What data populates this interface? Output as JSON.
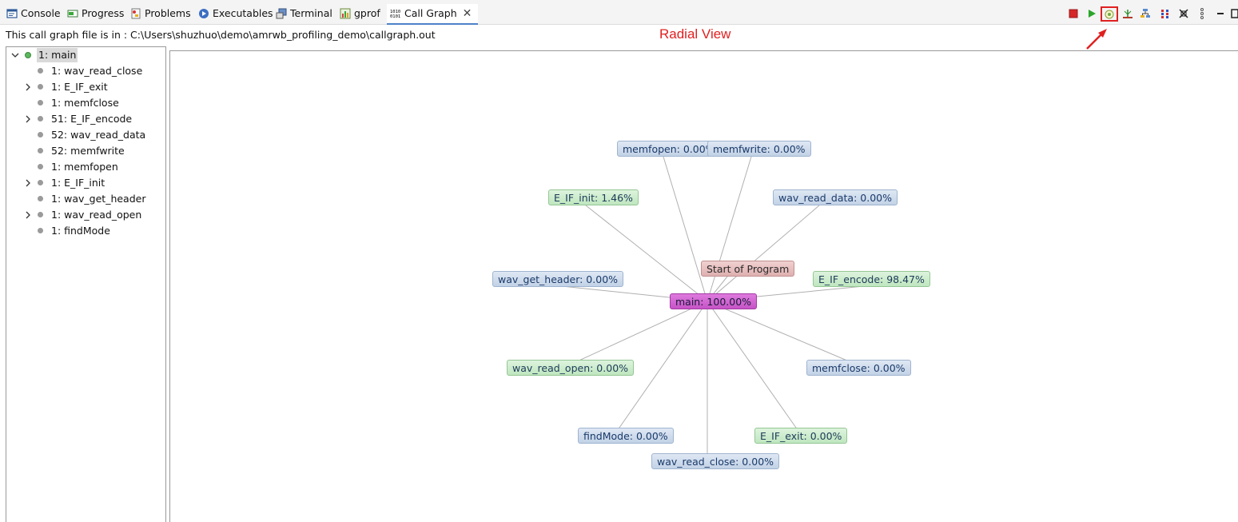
{
  "tabs": [
    {
      "label": "Console",
      "icon": "console-icon"
    },
    {
      "label": "Progress",
      "icon": "progress-icon"
    },
    {
      "label": "Problems",
      "icon": "problems-icon"
    },
    {
      "label": "Executables",
      "icon": "executables-icon"
    },
    {
      "label": "Terminal",
      "icon": "terminal-icon"
    },
    {
      "label": "gprof",
      "icon": "gprof-icon"
    },
    {
      "label": "Call Graph",
      "icon": "call-graph-icon",
      "active": true
    }
  ],
  "toolbar": {
    "icons": [
      "stop-icon",
      "play-icon",
      "radial-view-icon",
      "tree-view-icon",
      "level-view-icon",
      "aggregate-view-icon",
      "maximize-icon",
      "menu-icon",
      "restore-icon"
    ]
  },
  "info": {
    "filepath": "This call graph file is in : C:\\Users\\shuzhuo\\demo\\amrwb_profiling_demo\\callgraph.out"
  },
  "annotation": {
    "radial_label": "Radial View"
  },
  "tree": {
    "items": [
      {
        "label": "1: main",
        "expanded": true,
        "selected": true
      },
      {
        "label": "1: wav_read_close",
        "expandable": false
      },
      {
        "label": "1: E_IF_exit",
        "expandable": true
      },
      {
        "label": "1: memfclose",
        "expandable": false
      },
      {
        "label": "51: E_IF_encode",
        "expandable": true
      },
      {
        "label": "52: wav_read_data",
        "expandable": false
      },
      {
        "label": "52: memfwrite",
        "expandable": false
      },
      {
        "label": "1: memfopen",
        "expandable": false
      },
      {
        "label": "1: E_IF_init",
        "expandable": true
      },
      {
        "label": "1: wav_get_header",
        "expandable": false
      },
      {
        "label": "1: wav_read_open",
        "expandable": true
      },
      {
        "label": "1: findMode",
        "expandable": false
      }
    ]
  },
  "graph": {
    "center": {
      "label": "main: 100.00%"
    },
    "root": {
      "label": "Start of Program"
    },
    "nodes": [
      {
        "label": "memfopen: 0.00%",
        "color": "blue"
      },
      {
        "label": "memfwrite: 0.00%",
        "color": "blue"
      },
      {
        "label": "E_IF_init: 1.46%",
        "color": "green"
      },
      {
        "label": "wav_read_data: 0.00%",
        "color": "blue"
      },
      {
        "label": "E_IF_encode: 98.47%",
        "color": "green"
      },
      {
        "label": "wav_get_header: 0.00%",
        "color": "blue"
      },
      {
        "label": "wav_read_open: 0.00%",
        "color": "green"
      },
      {
        "label": "memfclose: 0.00%",
        "color": "blue"
      },
      {
        "label": "findMode: 0.00%",
        "color": "blue"
      },
      {
        "label": "E_IF_exit: 0.00%",
        "color": "green"
      },
      {
        "label": "wav_read_close: 0.00%",
        "color": "blue"
      }
    ]
  },
  "colors": {
    "accent_tab": "#4d82c7",
    "annotation_red": "#e02020",
    "edge": "#b0b0b0"
  }
}
